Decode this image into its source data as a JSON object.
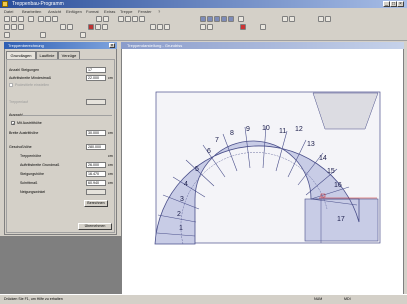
{
  "app": {
    "title": "Treppenbau-Programm"
  },
  "menu": [
    "Datei",
    "Bearbeiten",
    "Ansicht",
    "Einfügen",
    "Format",
    "Extras",
    "Treppe",
    "Fenster",
    "?"
  ],
  "panel": {
    "title": "Treppenberechnung",
    "tabs": [
      "Grundlagen",
      "Lauflinie",
      "Verzüge"
    ],
    "fields": [
      {
        "label": "Anzahl Steigungen",
        "value": "17",
        "unit": ""
      },
      {
        "label": "Auftrittsbreite Mindestmaß",
        "value": "22.000",
        "unit": "cm"
      }
    ],
    "grey_label_1": "Podesttiefe einstellen",
    "grey_label_2": "Treppenlauf",
    "section": "Auswahl",
    "checkbox_label": "Mit Austritthöhe",
    "checkbox_checked": true,
    "fields2": [
      {
        "label": "Breite Austritthöhe",
        "value": "30.000",
        "unit": "cm"
      }
    ],
    "section2": "Geschoßhöhe",
    "geschoss_value": "280.000",
    "fields3": [
      {
        "label": "Treppenhöhe",
        "value": "",
        "unit": "cm"
      },
      {
        "label": "Auftrittsbreite Grundmaß",
        "value": "26.000",
        "unit": "cm"
      },
      {
        "label": "Steigungshöhe",
        "value": "16.470",
        "unit": "cm"
      },
      {
        "label": "Schrittmaß",
        "value": "60.940",
        "unit": "cm"
      },
      {
        "label": "Neigungswinkel",
        "value": "",
        "unit": ""
      }
    ],
    "calc_button": "Berechnen",
    "ok_button": "Übernehmen"
  },
  "drawing": {
    "title": "Treppendarstellung - Grundriss",
    "step_numbers": [
      "1",
      "2",
      "3",
      "4",
      "5",
      "6",
      "7",
      "8",
      "9",
      "10",
      "11",
      "12",
      "13",
      "14",
      "15",
      "16",
      "17"
    ],
    "fill_color": "#c8cce6",
    "stroke_color": "#4a4f8a"
  },
  "status": {
    "left": "Drücken Sie F1, um Hilfe zu erhalten",
    "mid": "NUM",
    "right": "MDI"
  }
}
